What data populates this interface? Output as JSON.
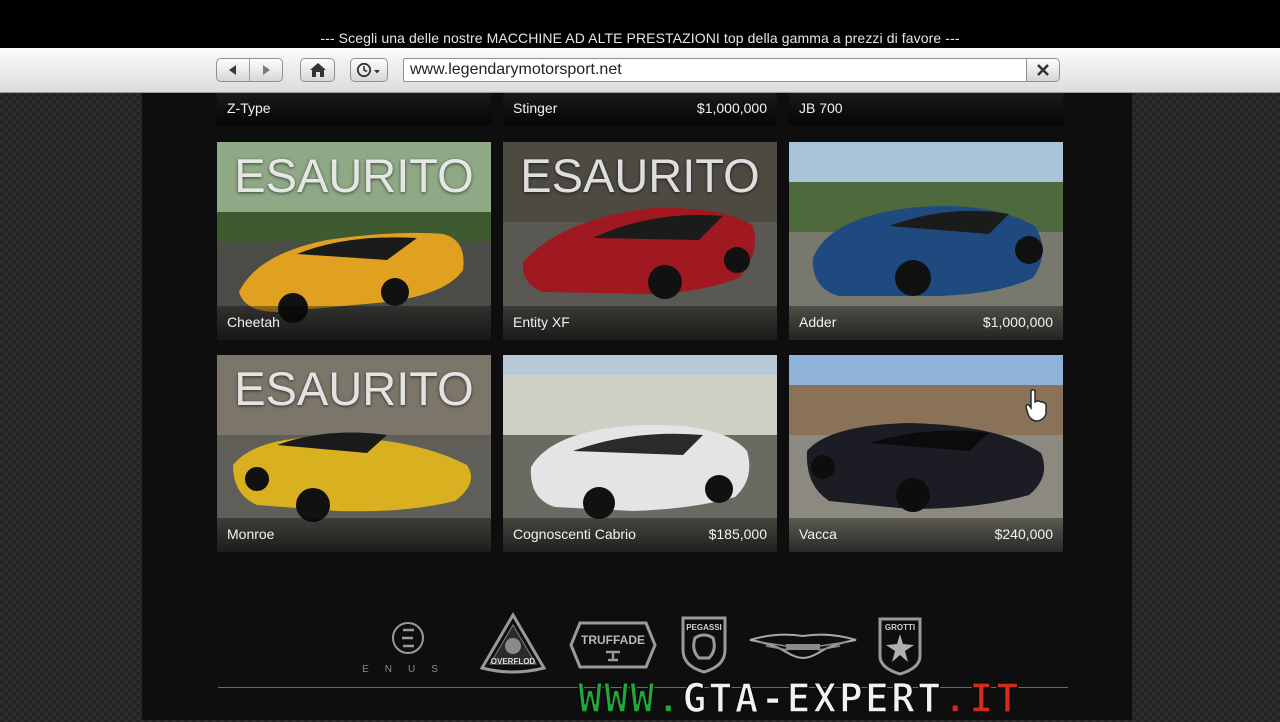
{
  "promo_text": "--- Scegli una delle nostre MACCHINE AD ALTE PRESTAZIONI top della gamma a prezzi di favore ---",
  "browser": {
    "url": "www.legendarymotorsport.net",
    "back_icon": "back-arrow-icon",
    "forward_icon": "forward-arrow-icon",
    "home_icon": "home-icon",
    "history_icon": "clock-icon",
    "close_icon": "close-icon"
  },
  "sold_label": "ESAURITO",
  "top_row": [
    {
      "name": "Z-Type",
      "price": ""
    },
    {
      "name": "Stinger",
      "price": "$1,000,000"
    },
    {
      "name": "JB 700",
      "price": ""
    }
  ],
  "cars": [
    {
      "name": "Cheetah",
      "price": "",
      "sold_out": true,
      "color": "#e0a020"
    },
    {
      "name": "Entity XF",
      "price": "",
      "sold_out": true,
      "color": "#a01820"
    },
    {
      "name": "Adder",
      "price": "$1,000,000",
      "sold_out": false,
      "color": "#1e4a80"
    },
    {
      "name": "Monroe",
      "price": "",
      "sold_out": true,
      "color": "#d8b020"
    },
    {
      "name": "Cognoscenti Cabrio",
      "price": "$185,000",
      "sold_out": false,
      "color": "#e4e4e4"
    },
    {
      "name": "Vacca",
      "price": "$240,000",
      "sold_out": false,
      "color": "#1c1c24"
    }
  ],
  "brands": [
    {
      "name": "ENUS",
      "icon": "enus-logo"
    },
    {
      "name": "OVERFLOD",
      "icon": "overflod-logo"
    },
    {
      "name": "TRUFFADE",
      "icon": "truffade-logo"
    },
    {
      "name": "PEGASSI",
      "icon": "pegassi-logo"
    },
    {
      "name": "",
      "icon": "winged-logo"
    },
    {
      "name": "GROTTI",
      "icon": "grotti-logo"
    }
  ],
  "watermark": {
    "part1": "WWW.",
    "part2": "GTA-EXPERT",
    "part3": ".IT"
  }
}
